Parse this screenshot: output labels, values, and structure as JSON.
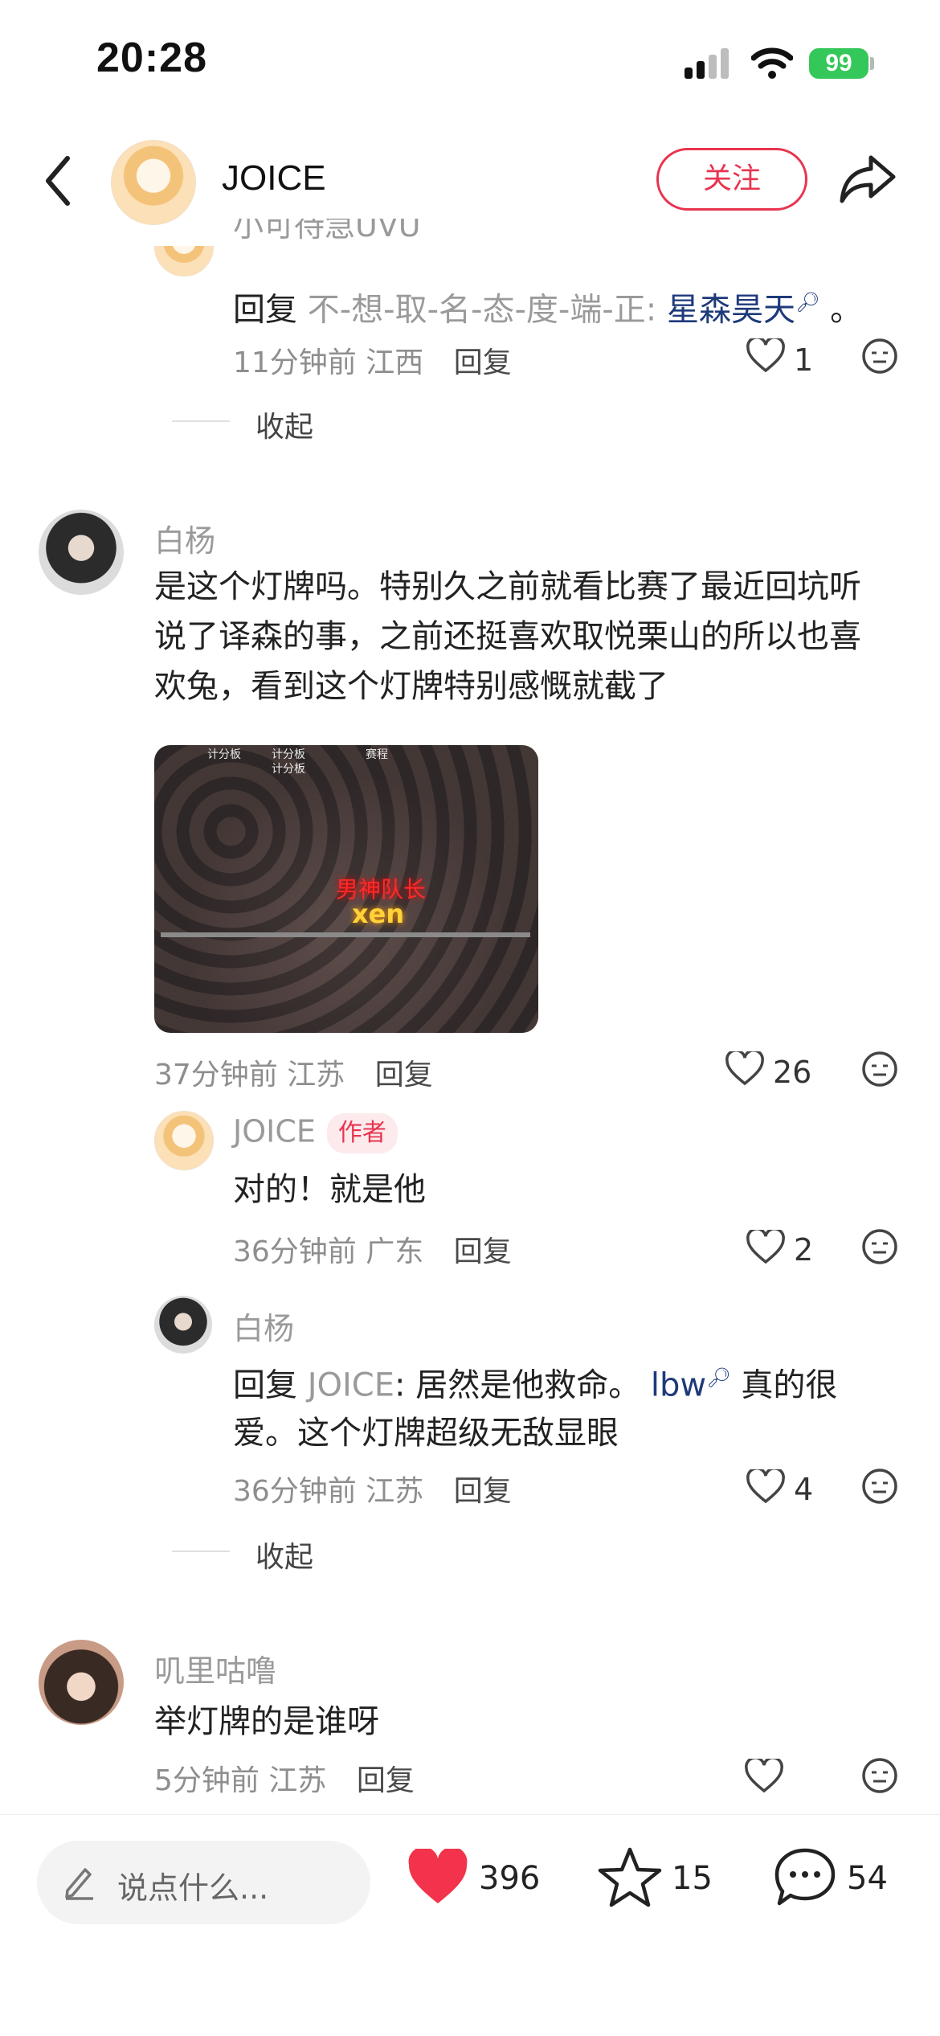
{
  "status_bar": {
    "time": "20:28",
    "battery": "99"
  },
  "header": {
    "name": "JOICE",
    "follow_label": "关注"
  },
  "comments": [
    {
      "user": "小可待急UVU",
      "reply_prefix": "回复",
      "reply_to": "不-想-取-名-态-度-端-正",
      "colon": ":",
      "mention": "星森昊天",
      "text_tail": " 。",
      "time": "11分钟前",
      "location": "江西",
      "reply_label": "回复",
      "likes": "1"
    },
    {
      "user": "白杨",
      "text_lines": [
        "是这个灯牌吗。特别久之前就看比赛了最近回坑听",
        "说了译森的事，之前还挺喜欢取悦栗山的所以也喜",
        "欢兔，看到这个灯牌特别感慨就截了"
      ],
      "image_tabs": [
        "计分板",
        "计分板",
        "赛程",
        "计分板"
      ],
      "image_neon_top": "男神队长",
      "image_neon_bottom": "xen",
      "time": "37分钟前",
      "location": "江苏",
      "reply_label": "回复",
      "likes": "26"
    },
    {
      "user": "JOICE",
      "badge": "作者",
      "text": "对的！就是他",
      "time": "36分钟前",
      "location": "广东",
      "reply_label": "回复",
      "likes": "2"
    },
    {
      "user": "白杨",
      "reply_prefix": "回复",
      "reply_to": "JOICE",
      "colon": ":",
      "text_a": " 居然是他救命。 ",
      "mention": "lbw",
      "text_b": " 真的很",
      "text_line2": "爱。这个灯牌超级无敌显眼",
      "time": "36分钟前",
      "location": "江苏",
      "reply_label": "回复",
      "likes": "4"
    },
    {
      "user": "叽里咕噜",
      "text": "举灯牌的是谁呀",
      "time": "5分钟前",
      "location": "江苏",
      "reply_label": "回复",
      "likes": ""
    }
  ],
  "collapse_label": "收起",
  "bottom_bar": {
    "input_placeholder": "说点什么...",
    "likes": "396",
    "favorites": "15",
    "comments": "54"
  },
  "colors": {
    "accent": "#e8344f",
    "link": "#1e3a7a",
    "battery": "#34c759"
  }
}
